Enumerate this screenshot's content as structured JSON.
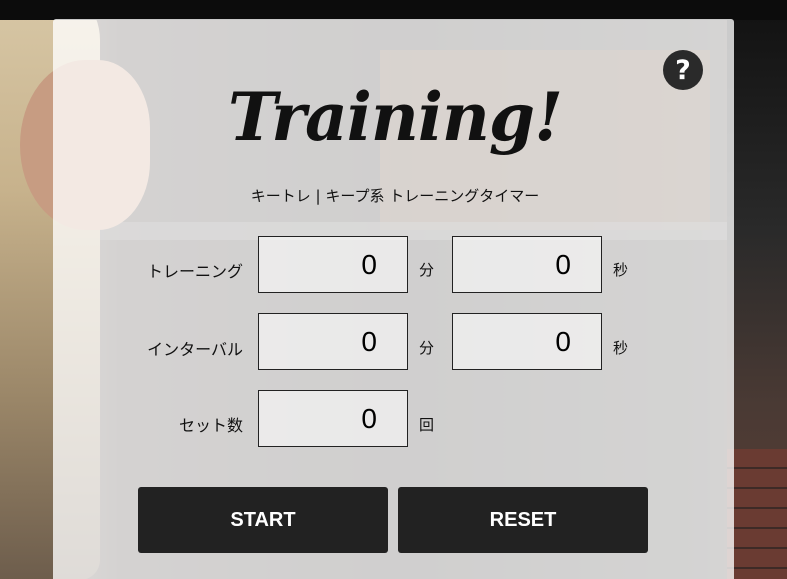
{
  "app": {
    "title": "Training!",
    "subtitle": "キートレ | キープ系 トレーニングタイマー",
    "help_icon": "?"
  },
  "rows": {
    "training": {
      "label": "トレーニング",
      "minutes": "0",
      "minutes_unit": "分",
      "seconds": "0",
      "seconds_unit": "秒"
    },
    "interval": {
      "label": "インターバル",
      "minutes": "0",
      "minutes_unit": "分",
      "seconds": "0",
      "seconds_unit": "秒"
    },
    "sets": {
      "label": "セット数",
      "count": "0",
      "count_unit": "回"
    }
  },
  "buttons": {
    "start": "START",
    "reset": "RESET"
  },
  "colors": {
    "button_bg": "#222222",
    "panel_bg": "rgba(255,255,255,0.78)"
  }
}
